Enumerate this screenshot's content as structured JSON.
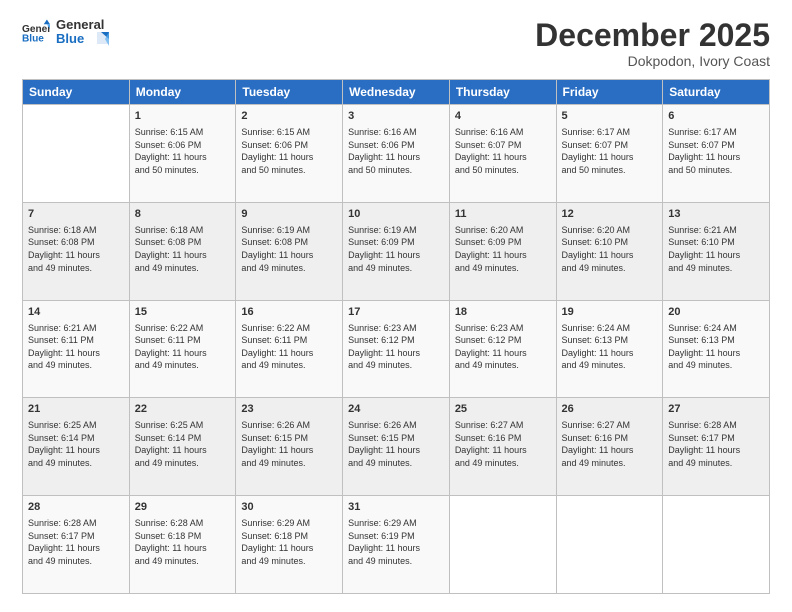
{
  "header": {
    "logo_line1": "General",
    "logo_line2": "Blue",
    "month_title": "December 2025",
    "location": "Dokpodon, Ivory Coast"
  },
  "days_of_week": [
    "Sunday",
    "Monday",
    "Tuesday",
    "Wednesday",
    "Thursday",
    "Friday",
    "Saturday"
  ],
  "weeks": [
    [
      {
        "day": "",
        "info": ""
      },
      {
        "day": "1",
        "info": "Sunrise: 6:15 AM\nSunset: 6:06 PM\nDaylight: 11 hours\nand 50 minutes."
      },
      {
        "day": "2",
        "info": "Sunrise: 6:15 AM\nSunset: 6:06 PM\nDaylight: 11 hours\nand 50 minutes."
      },
      {
        "day": "3",
        "info": "Sunrise: 6:16 AM\nSunset: 6:06 PM\nDaylight: 11 hours\nand 50 minutes."
      },
      {
        "day": "4",
        "info": "Sunrise: 6:16 AM\nSunset: 6:07 PM\nDaylight: 11 hours\nand 50 minutes."
      },
      {
        "day": "5",
        "info": "Sunrise: 6:17 AM\nSunset: 6:07 PM\nDaylight: 11 hours\nand 50 minutes."
      },
      {
        "day": "6",
        "info": "Sunrise: 6:17 AM\nSunset: 6:07 PM\nDaylight: 11 hours\nand 50 minutes."
      }
    ],
    [
      {
        "day": "7",
        "info": "Sunrise: 6:18 AM\nSunset: 6:08 PM\nDaylight: 11 hours\nand 49 minutes."
      },
      {
        "day": "8",
        "info": "Sunrise: 6:18 AM\nSunset: 6:08 PM\nDaylight: 11 hours\nand 49 minutes."
      },
      {
        "day": "9",
        "info": "Sunrise: 6:19 AM\nSunset: 6:08 PM\nDaylight: 11 hours\nand 49 minutes."
      },
      {
        "day": "10",
        "info": "Sunrise: 6:19 AM\nSunset: 6:09 PM\nDaylight: 11 hours\nand 49 minutes."
      },
      {
        "day": "11",
        "info": "Sunrise: 6:20 AM\nSunset: 6:09 PM\nDaylight: 11 hours\nand 49 minutes."
      },
      {
        "day": "12",
        "info": "Sunrise: 6:20 AM\nSunset: 6:10 PM\nDaylight: 11 hours\nand 49 minutes."
      },
      {
        "day": "13",
        "info": "Sunrise: 6:21 AM\nSunset: 6:10 PM\nDaylight: 11 hours\nand 49 minutes."
      }
    ],
    [
      {
        "day": "14",
        "info": "Sunrise: 6:21 AM\nSunset: 6:11 PM\nDaylight: 11 hours\nand 49 minutes."
      },
      {
        "day": "15",
        "info": "Sunrise: 6:22 AM\nSunset: 6:11 PM\nDaylight: 11 hours\nand 49 minutes."
      },
      {
        "day": "16",
        "info": "Sunrise: 6:22 AM\nSunset: 6:11 PM\nDaylight: 11 hours\nand 49 minutes."
      },
      {
        "day": "17",
        "info": "Sunrise: 6:23 AM\nSunset: 6:12 PM\nDaylight: 11 hours\nand 49 minutes."
      },
      {
        "day": "18",
        "info": "Sunrise: 6:23 AM\nSunset: 6:12 PM\nDaylight: 11 hours\nand 49 minutes."
      },
      {
        "day": "19",
        "info": "Sunrise: 6:24 AM\nSunset: 6:13 PM\nDaylight: 11 hours\nand 49 minutes."
      },
      {
        "day": "20",
        "info": "Sunrise: 6:24 AM\nSunset: 6:13 PM\nDaylight: 11 hours\nand 49 minutes."
      }
    ],
    [
      {
        "day": "21",
        "info": "Sunrise: 6:25 AM\nSunset: 6:14 PM\nDaylight: 11 hours\nand 49 minutes."
      },
      {
        "day": "22",
        "info": "Sunrise: 6:25 AM\nSunset: 6:14 PM\nDaylight: 11 hours\nand 49 minutes."
      },
      {
        "day": "23",
        "info": "Sunrise: 6:26 AM\nSunset: 6:15 PM\nDaylight: 11 hours\nand 49 minutes."
      },
      {
        "day": "24",
        "info": "Sunrise: 6:26 AM\nSunset: 6:15 PM\nDaylight: 11 hours\nand 49 minutes."
      },
      {
        "day": "25",
        "info": "Sunrise: 6:27 AM\nSunset: 6:16 PM\nDaylight: 11 hours\nand 49 minutes."
      },
      {
        "day": "26",
        "info": "Sunrise: 6:27 AM\nSunset: 6:16 PM\nDaylight: 11 hours\nand 49 minutes."
      },
      {
        "day": "27",
        "info": "Sunrise: 6:28 AM\nSunset: 6:17 PM\nDaylight: 11 hours\nand 49 minutes."
      }
    ],
    [
      {
        "day": "28",
        "info": "Sunrise: 6:28 AM\nSunset: 6:17 PM\nDaylight: 11 hours\nand 49 minutes."
      },
      {
        "day": "29",
        "info": "Sunrise: 6:28 AM\nSunset: 6:18 PM\nDaylight: 11 hours\nand 49 minutes."
      },
      {
        "day": "30",
        "info": "Sunrise: 6:29 AM\nSunset: 6:18 PM\nDaylight: 11 hours\nand 49 minutes."
      },
      {
        "day": "31",
        "info": "Sunrise: 6:29 AM\nSunset: 6:19 PM\nDaylight: 11 hours\nand 49 minutes."
      },
      {
        "day": "",
        "info": ""
      },
      {
        "day": "",
        "info": ""
      },
      {
        "day": "",
        "info": ""
      }
    ]
  ]
}
